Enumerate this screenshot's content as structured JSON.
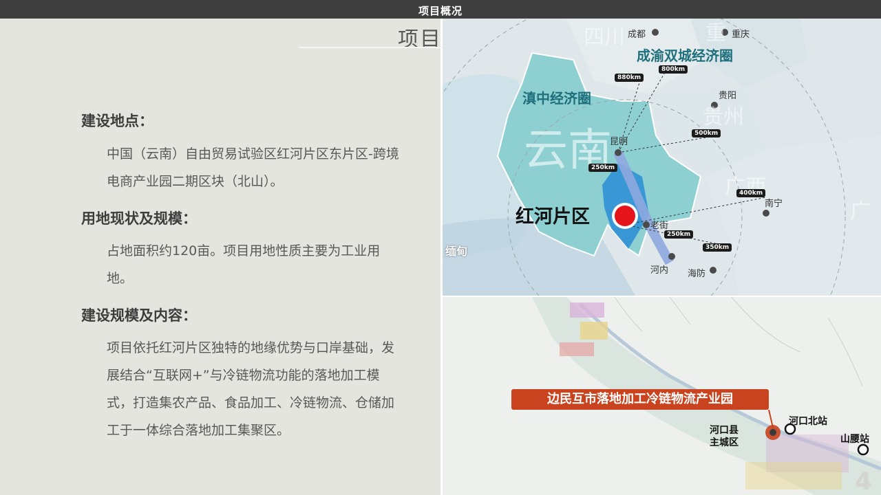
{
  "header": {
    "title": "项目概况"
  },
  "page": {
    "title": "项目简介",
    "page_number": "4"
  },
  "sections": [
    {
      "heading": "建设地点：",
      "body": "中国（云南）自由贸易试验区红河片区东片区-跨境电商产业园二期区块（北山）。"
    },
    {
      "heading": "用地现状及规模：",
      "body": "占地面积约120亩。项目用地性质主要为工业用地。"
    },
    {
      "heading": "建设规模及内容：",
      "body": "项目依托红河片区独特的地缘优势与口岸基础，发展结合“互联网+”与冷链物流功能的落地加工模式，打造集农产品、食品加工、冷链物流、仓储加工于一体综合落地加工集聚区。"
    }
  ],
  "regional_map": {
    "zone_label": "红河片区",
    "circles": [
      "成渝双城经济圈",
      "滇中经济圈"
    ],
    "provinces": [
      "云南",
      "四川",
      "重",
      "贵州",
      "广西",
      "广"
    ],
    "neighbor_country": "缅甸",
    "cities": [
      "成都",
      "重庆",
      "贵阳",
      "昆明",
      "南宁",
      "老街",
      "河内",
      "海防"
    ],
    "distances": [
      "880km",
      "800km",
      "500km",
      "250km",
      "400km",
      "250km",
      "350km"
    ]
  },
  "local_map": {
    "park_label": "边民互市落地加工冷链物流产业园",
    "stations": [
      "河口北站",
      "山腰站"
    ],
    "county_area": "河口县\n主城区"
  },
  "colors": {
    "header_bg": "#3e3e3e",
    "panel_bg": "#e4e5df",
    "yunnan": "#8ed0d2",
    "zone_red": "#e5141a",
    "banner": "#c9431f"
  }
}
